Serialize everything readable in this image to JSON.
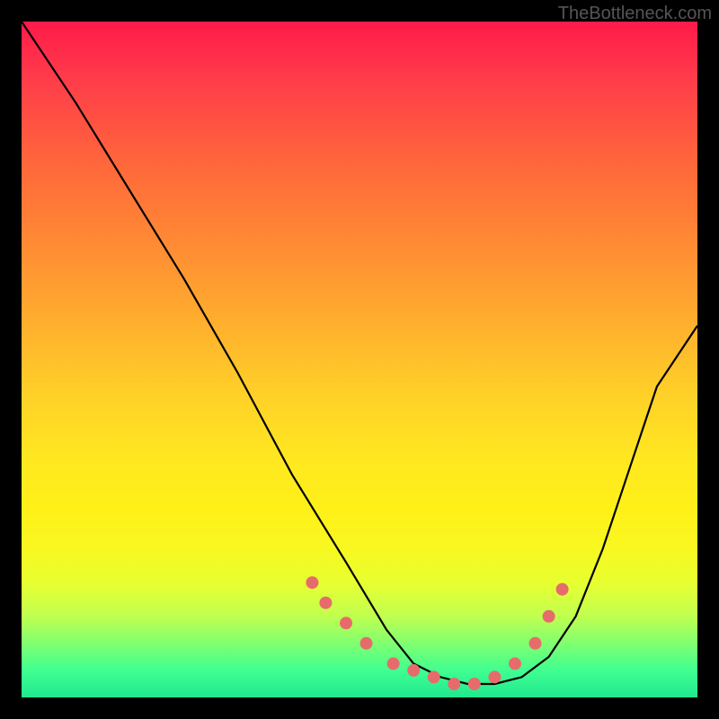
{
  "watermark": "TheBottleneck.com",
  "chart_data": {
    "type": "line",
    "title": "",
    "xlabel": "",
    "ylabel": "",
    "xlim": [
      0,
      100
    ],
    "ylim": [
      0,
      100
    ],
    "series": [
      {
        "name": "curve",
        "x": [
          0,
          8,
          16,
          24,
          32,
          40,
          48,
          54,
          58,
          62,
          66,
          70,
          74,
          78,
          82,
          86,
          90,
          94,
          100
        ],
        "values": [
          100,
          88,
          75,
          62,
          48,
          33,
          20,
          10,
          5,
          3,
          2,
          2,
          3,
          6,
          12,
          22,
          34,
          46,
          55
        ]
      }
    ],
    "markers": {
      "name": "highlight-points",
      "color": "#e86b6b",
      "x": [
        43,
        45,
        48,
        51,
        55,
        58,
        61,
        64,
        67,
        70,
        73,
        76,
        78,
        80
      ],
      "values": [
        17,
        14,
        11,
        8,
        5,
        4,
        3,
        2,
        2,
        3,
        5,
        8,
        12,
        16
      ]
    },
    "gradient_bands": [
      {
        "y": 0,
        "color": "#ff1a4a"
      },
      {
        "y": 50,
        "color": "#ffd028"
      },
      {
        "y": 80,
        "color": "#f0ff20"
      },
      {
        "y": 100,
        "color": "#20e890"
      }
    ]
  }
}
